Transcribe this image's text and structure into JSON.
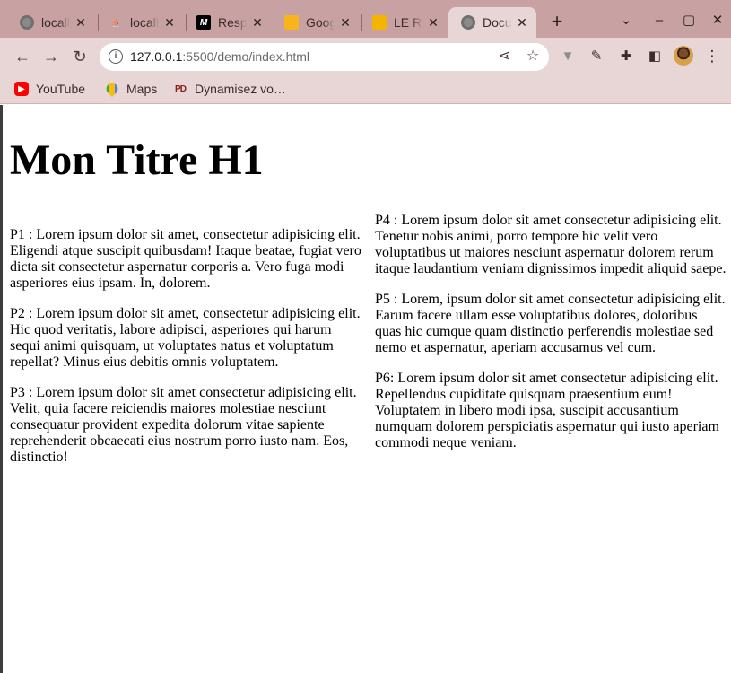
{
  "browser": {
    "tabs": [
      {
        "title": "localhost",
        "favicon": "globe-icon",
        "active": false
      },
      {
        "title": "localhost",
        "favicon": "phpmyadmin-icon",
        "active": false
      },
      {
        "title": "Responsive",
        "favicon": "m-logo-icon",
        "active": false
      },
      {
        "title": "Google",
        "favicon": "google-doc-icon",
        "active": false
      },
      {
        "title": "LE R",
        "favicon": "slides-icon",
        "active": false
      },
      {
        "title": "Document",
        "favicon": "globe-icon",
        "active": true
      }
    ],
    "url_host": "127.0.0.1",
    "url_rest": ":5500/demo/index.html",
    "bookmarks": [
      {
        "label": "YouTube",
        "favicon": "youtube-icon"
      },
      {
        "label": "Maps",
        "favicon": "maps-icon"
      },
      {
        "label": "Dynamisez vo…",
        "favicon": "pd-icon"
      }
    ],
    "colors": {
      "tabbar": "#c8a1a3",
      "toolbar": "#e8d5d6"
    }
  },
  "page": {
    "heading": "Mon Titre H1",
    "left_paragraphs": [
      "P1 : Lorem ipsum dolor sit amet, consectetur adipisicing elit. Eligendi atque suscipit quibusdam! Itaque beatae, fugiat vero dicta sit consectetur aspernatur corporis a. Vero fuga modi asperiores eius ipsam. In, dolorem.",
      "P2 : Lorem ipsum dolor sit amet, consectetur adipisicing elit. Hic quod veritatis, labore adipisci, asperiores qui harum sequi animi quisquam, ut voluptates natus et voluptatum repellat? Minus eius debitis omnis voluptatem.",
      "P3 : Lorem ipsum dolor sit amet consectetur adipisicing elit. Velit, quia facere reiciendis maiores molestiae nesciunt consequatur provident expedita dolorum vitae sapiente reprehenderit obcaecati eius nostrum porro iusto nam. Eos, distinctio!"
    ],
    "right_paragraphs": [
      "P4 : Lorem ipsum dolor sit amet consectetur adipisicing elit. Tenetur nobis animi, porro tempore hic velit vero voluptatibus ut maiores nesciunt aspernatur dolorem rerum itaque laudantium veniam dignissimos impedit aliquid saepe.",
      "P5 : Lorem, ipsum dolor sit amet consectetur adipisicing elit. Earum facere ullam esse voluptatibus dolores, doloribus quas hic cumque quam distinctio perferendis molestiae sed nemo et aspernatur, aperiam accusamus vel cum.",
      "P6: Lorem ipsum dolor sit amet consectetur adipisicing elit. Repellendus cupiditate quisquam praesentium eum! Voluptatem in libero modi ipsa, suscipit accusantium numquam dolorem perspiciatis aspernatur qui iusto aperiam commodi neque veniam."
    ]
  }
}
